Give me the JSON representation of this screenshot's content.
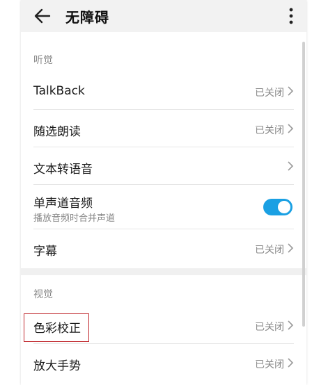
{
  "header": {
    "title": "无障碍"
  },
  "sections": {
    "hearing": {
      "label": "听觉",
      "items": [
        {
          "label": "TalkBack",
          "status": "已关闭"
        },
        {
          "label": "随选朗读",
          "status": "已关闭"
        },
        {
          "label": "文本转语音",
          "status": ""
        },
        {
          "label": "单声道音频",
          "sub": "播放音频时合并声道",
          "toggle": "on"
        },
        {
          "label": "字幕",
          "status": "已关闭"
        }
      ]
    },
    "vision": {
      "label": "视觉",
      "items": [
        {
          "label": "色彩校正",
          "status": "已关闭"
        },
        {
          "label": "放大手势",
          "status": "已关闭"
        }
      ]
    }
  },
  "colors": {
    "accent": "#1aa0e3",
    "highlight_box": "#c0282d",
    "header_bg": "#f2f2f2"
  },
  "icons": {
    "back": "arrow-left-icon",
    "more": "more-vertical-icon",
    "chevron": "chevron-right-icon"
  }
}
